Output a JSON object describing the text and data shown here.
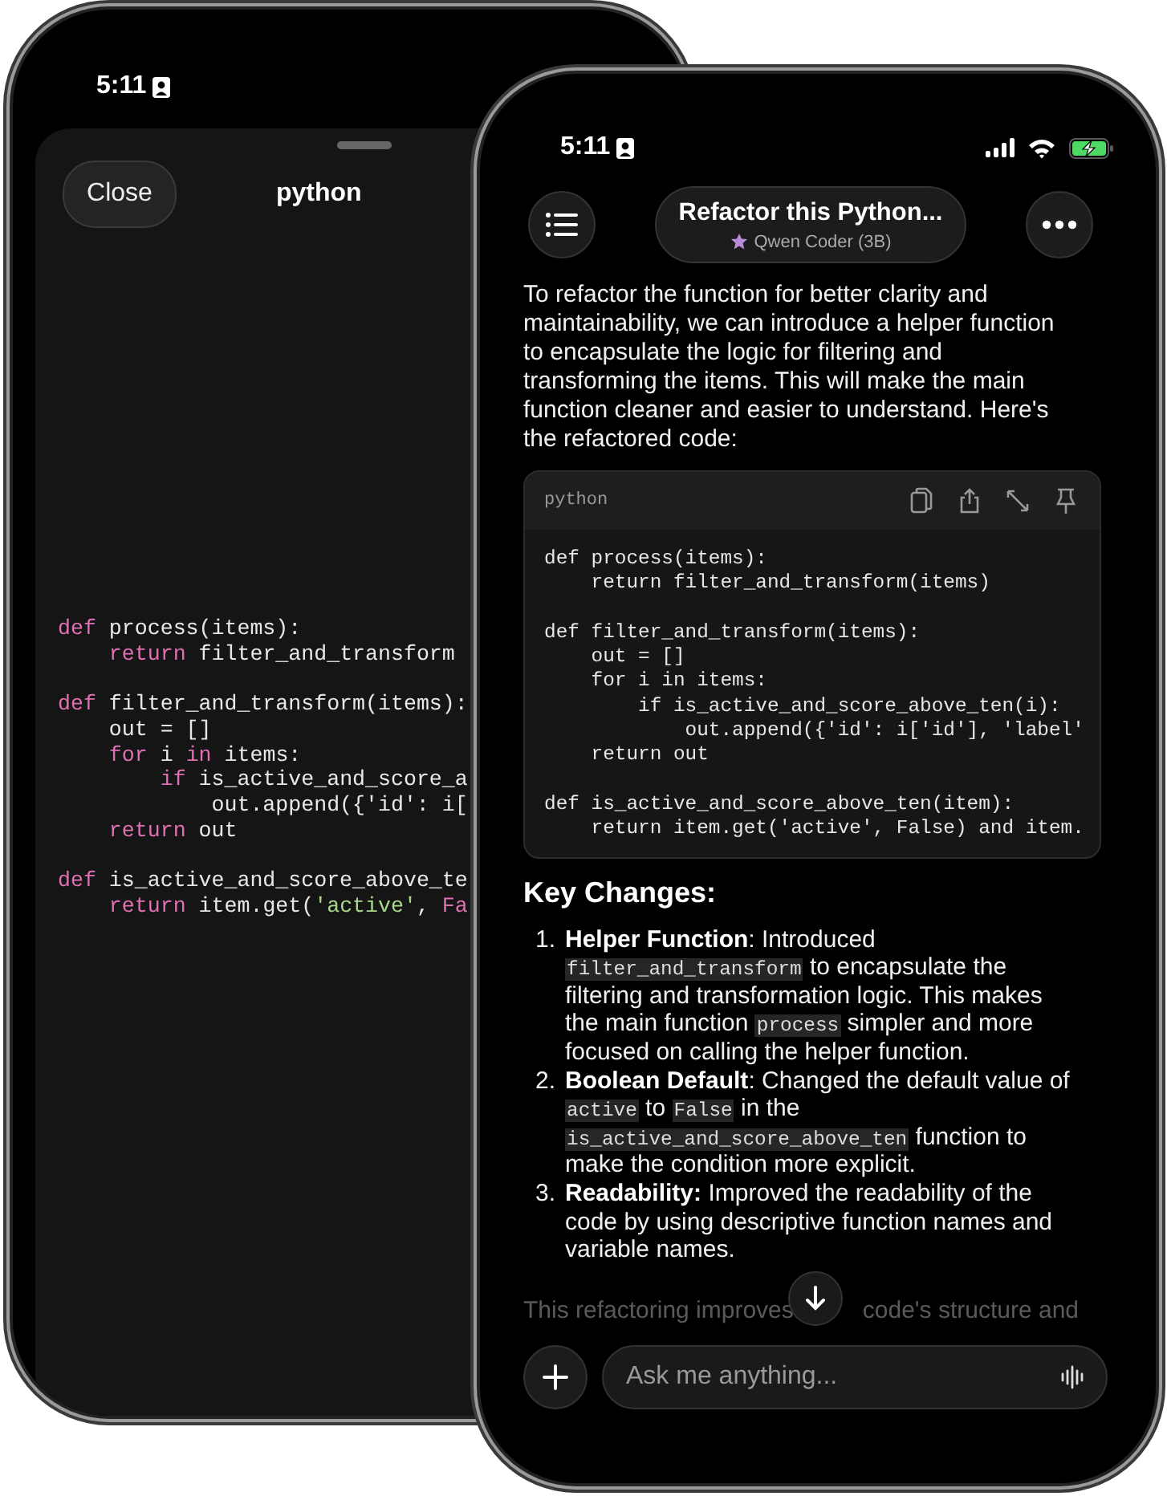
{
  "back_phone": {
    "status_bar": {
      "time": "5:11"
    },
    "sheet": {
      "close_button": "Close",
      "title": "python",
      "code_tokens": [
        {
          "kind": "keyword",
          "text": "def"
        },
        {
          "kind": "plain",
          "text": " process(items):\n    "
        },
        {
          "kind": "keyword",
          "text": "return"
        },
        {
          "kind": "plain",
          "text": " filter_and_transform\n\n"
        },
        {
          "kind": "keyword",
          "text": "def"
        },
        {
          "kind": "plain",
          "text": " filter_and_transform(items):\n    out = []\n    "
        },
        {
          "kind": "keyword",
          "text": "for"
        },
        {
          "kind": "plain",
          "text": " i "
        },
        {
          "kind": "keyword",
          "text": "in"
        },
        {
          "kind": "plain",
          "text": " items:\n        "
        },
        {
          "kind": "keyword",
          "text": "if"
        },
        {
          "kind": "plain",
          "text": " is_active_and_score_a\n            out.append({'id': i[\n    "
        },
        {
          "kind": "keyword",
          "text": "return"
        },
        {
          "kind": "plain",
          "text": " out\n\n"
        },
        {
          "kind": "keyword",
          "text": "def"
        },
        {
          "kind": "plain",
          "text": " is_active_and_score_above_te\n    "
        },
        {
          "kind": "keyword",
          "text": "return"
        },
        {
          "kind": "plain",
          "text": " item.get("
        },
        {
          "kind": "string",
          "text": "'active'"
        },
        {
          "kind": "plain",
          "text": ", "
        },
        {
          "kind": "keyword",
          "text": "Fa"
        }
      ]
    }
  },
  "front_phone": {
    "status_bar": {
      "time": "5:11"
    },
    "header": {
      "title": "Refactor this Python...",
      "model": "Qwen Coder (3B)"
    },
    "message": {
      "intro": "To refactor the function for better clarity and maintainability, we can introduce a helper function to encapsulate the logic for filtering and transforming the items. This will make the main function cleaner and easier to understand. Here's the refactored code:",
      "code_block": {
        "language": "python",
        "code": "def process(items):\n    return filter_and_transform(items)\n\ndef filter_and_transform(items):\n    out = []\n    for i in items:\n        if is_active_and_score_above_ten(i):\n            out.append({'id': i['id'], 'label'\n    return out\n\ndef is_active_and_score_above_ten(item):\n    return item.get('active', False) and item."
      },
      "heading": "Key Changes:",
      "changes": [
        {
          "number": "1.",
          "segments": [
            {
              "kind": "bold",
              "text": "Helper Function"
            },
            {
              "kind": "text",
              "text": ": Introduced "
            },
            {
              "kind": "code",
              "text": "filter_and_transform"
            },
            {
              "kind": "text",
              "text": " to encapsulate the filtering and transformation logic. This makes the main function "
            },
            {
              "kind": "code",
              "text": "process"
            },
            {
              "kind": "text",
              "text": " simpler and more focused on calling the helper function."
            }
          ]
        },
        {
          "number": "2.",
          "segments": [
            {
              "kind": "bold",
              "text": "Boolean Default"
            },
            {
              "kind": "text",
              "text": ": Changed the default value of "
            },
            {
              "kind": "code",
              "text": "active"
            },
            {
              "kind": "text",
              "text": " to "
            },
            {
              "kind": "code",
              "text": "False"
            },
            {
              "kind": "text",
              "text": " in the "
            },
            {
              "kind": "code",
              "text": "is_active_and_score_above_ten"
            },
            {
              "kind": "text",
              "text": " function to make the condition more explicit."
            }
          ]
        },
        {
          "number": "3.",
          "segments": [
            {
              "kind": "bold",
              "text": "Readability:"
            },
            {
              "kind": "text",
              "text": " Improved the readability of the code by using descriptive function names and variable names."
            }
          ]
        }
      ],
      "faded_text": [
        "This refactoring improves",
        "code's structure and"
      ]
    },
    "composer": {
      "placeholder": "Ask me anything..."
    }
  }
}
